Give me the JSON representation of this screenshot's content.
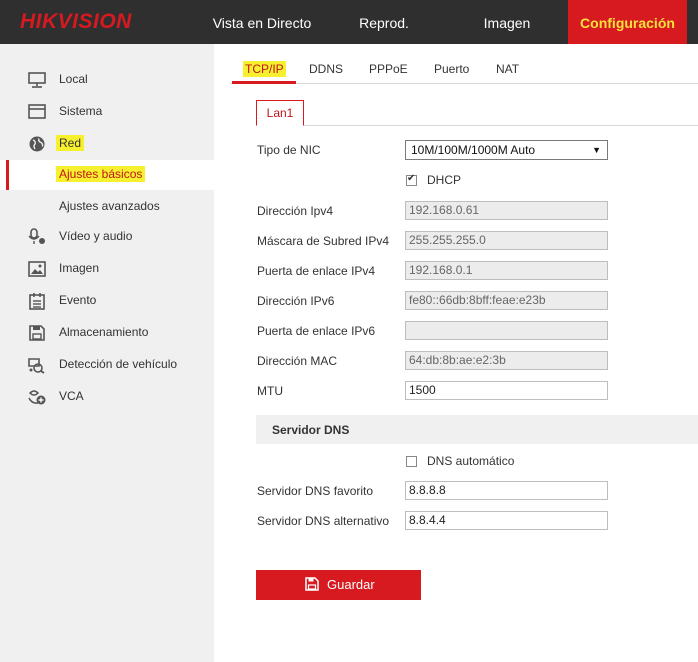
{
  "header": {
    "logo": "HIKVISION",
    "nav": [
      {
        "label": "Vista en Directo"
      },
      {
        "label": "Reprod."
      },
      {
        "label": "Imagen"
      },
      {
        "label": "Configuración",
        "active": true
      }
    ]
  },
  "sidebar": {
    "items": [
      {
        "label": "Local",
        "icon": "monitor-icon"
      },
      {
        "label": "Sistema",
        "icon": "window-icon"
      },
      {
        "label": "Red",
        "icon": "globe-icon",
        "active": true
      },
      {
        "label": "Ajustes básicos",
        "sub": true,
        "active": true
      },
      {
        "label": "Ajustes avanzados",
        "sub": true
      },
      {
        "label": "Vídeo y audio",
        "icon": "microphone-icon"
      },
      {
        "label": "Imagen",
        "icon": "image-icon"
      },
      {
        "label": "Evento",
        "icon": "calendar-icon"
      },
      {
        "label": "Almacenamiento",
        "icon": "floppy-icon"
      },
      {
        "label": "Detección de vehículo",
        "icon": "vehicle-search-icon"
      },
      {
        "label": "VCA",
        "icon": "vca-icon"
      }
    ]
  },
  "tabs": [
    {
      "label": "TCP/IP",
      "active": true
    },
    {
      "label": "DDNS"
    },
    {
      "label": "PPPoE"
    },
    {
      "label": "Puerto"
    },
    {
      "label": "NAT"
    }
  ],
  "subtab": {
    "label": "Lan1"
  },
  "form": {
    "nic_type": {
      "label": "Tipo de NIC",
      "value": "10M/100M/1000M Auto"
    },
    "dhcp": {
      "label": "DHCP",
      "checked": true
    },
    "ipv4": {
      "label": "Dirección Ipv4",
      "value": "192.168.0.61"
    },
    "mask": {
      "label": "Máscara de Subred IPv4",
      "value": "255.255.255.0"
    },
    "gateway4": {
      "label": "Puerta de enlace IPv4",
      "value": "192.168.0.1"
    },
    "ipv6": {
      "label": "Dirección IPv6",
      "value": "fe80::66db:8bff:feae:e23b"
    },
    "gateway6": {
      "label": "Puerta de enlace IPv6",
      "value": ""
    },
    "mac": {
      "label": "Dirección MAC",
      "value": "64:db:8b:ae:e2:3b"
    },
    "mtu": {
      "label": "MTU",
      "value": "1500"
    }
  },
  "dns": {
    "section_label": "Servidor DNS",
    "auto": {
      "label": "DNS automático",
      "checked": false
    },
    "preferred": {
      "label": "Servidor DNS favorito",
      "value": "8.8.8.8"
    },
    "alternate": {
      "label": "Servidor DNS alternativo",
      "value": "8.8.4.4"
    }
  },
  "save_button": {
    "label": "Guardar",
    "icon": "floppy-icon"
  },
  "colors": {
    "accent": "#d71920",
    "highlight": "#f7f02e",
    "topbar": "#2f2f2f",
    "sidebar": "#f0f0f0"
  }
}
